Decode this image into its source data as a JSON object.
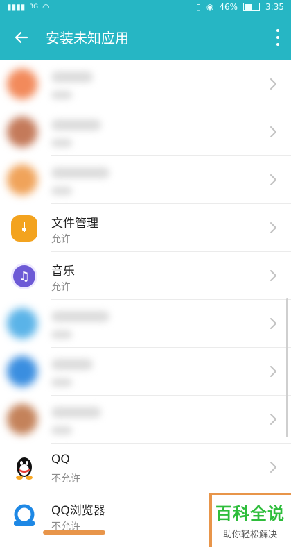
{
  "statusbar": {
    "signal_label": "3G",
    "battery_pct": "46%",
    "time": "3:35",
    "battery_level": 0.46
  },
  "header": {
    "title": "安装未知应用"
  },
  "rows": [
    {
      "name": "",
      "perm": "",
      "color": "#f28a5b"
    },
    {
      "name": "",
      "perm": "",
      "color": "#c47a5a"
    },
    {
      "name": "",
      "perm": "",
      "color": "#f0a35a"
    },
    {
      "name": "文件管理",
      "perm": "允许",
      "color": "#f3a31f",
      "icon": "file-manager-icon"
    },
    {
      "name": "音乐",
      "perm": "允许",
      "color": "#6d5ad6",
      "icon": "music-icon"
    },
    {
      "name": "",
      "perm": "",
      "color": "#5ab3e8"
    },
    {
      "name": "",
      "perm": "",
      "color": "#3a8ee0"
    },
    {
      "name": "",
      "perm": "",
      "color": "#c4825a"
    },
    {
      "name": "QQ",
      "perm": "不允许",
      "color": "#ffffff",
      "icon": "qq-penguin-icon"
    },
    {
      "name": "QQ浏览器",
      "perm": "不允许",
      "color": "#ffffff",
      "icon": "qq-browser-icon"
    }
  ],
  "watermark": {
    "title": "百科全说",
    "subtitle": "助你轻松解决"
  }
}
